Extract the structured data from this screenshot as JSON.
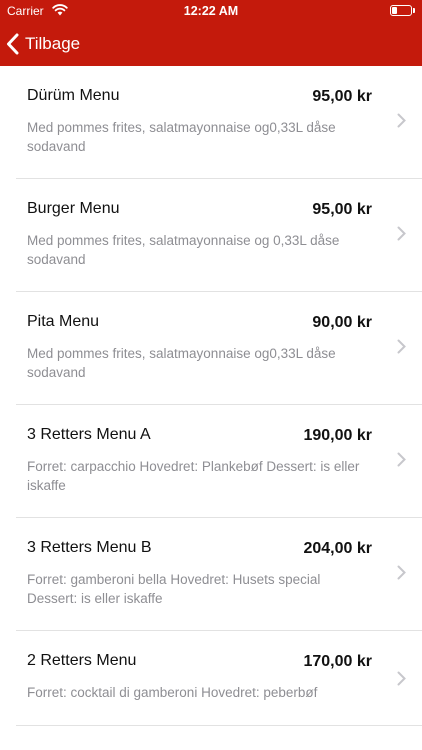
{
  "status": {
    "carrier": "Carrier",
    "time": "12:22 AM",
    "icons": [
      "wifi-icon",
      "battery-icon"
    ]
  },
  "nav": {
    "back_label": "Tilbage",
    "back_icon": "chevron-left-icon",
    "bar_color": "#c41a0c"
  },
  "menu": [
    {
      "name": "Dürüm Menu",
      "price": "95,00 kr",
      "description": "Med pommes frites, salatmayonnaise og0,33L dåse sodavand"
    },
    {
      "name": "Burger Menu",
      "price": "95,00 kr",
      "description": "Med pommes frites, salatmayonnaise og 0,33L dåse sodavand"
    },
    {
      "name": "Pita Menu",
      "price": "90,00 kr",
      "description": "Med pommes frites, salatmayonnaise og0,33L dåse sodavand"
    },
    {
      "name": "3 Retters Menu A",
      "price": "190,00 kr",
      "description": "Forret: carpacchio Hovedret: Plankebøf Dessert: is eller iskaffe"
    },
    {
      "name": "3 Retters Menu B",
      "price": "204,00 kr",
      "description": "Forret: gamberoni bella Hovedret: Husets special Dessert: is eller iskaffe"
    },
    {
      "name": "2 Retters Menu",
      "price": "170,00 kr",
      "description": "Forret: cocktail di gamberoni Hovedret: peberbøf"
    }
  ]
}
